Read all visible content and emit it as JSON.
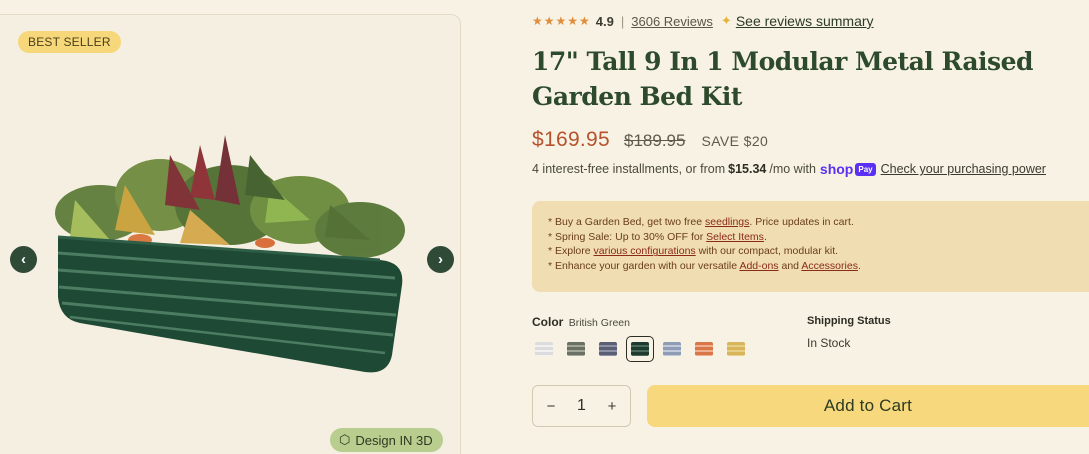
{
  "gallery": {
    "badge": "BEST SELLER",
    "prev_icon": "‹",
    "next_icon": "›",
    "design_label": "Design IN 3D",
    "design_icon": "⬡"
  },
  "product": {
    "stars": "★★★★★",
    "rating": "4.9",
    "rating_sep": "|",
    "reviews": "3606 Reviews",
    "sparkle_icon": "✦",
    "summary_link": "See reviews summary",
    "title": "17\" Tall 9 In 1 Modular Metal Raised Garden Bed Kit",
    "price": "$169.95",
    "old_price": "$189.95",
    "save": "SAVE $20",
    "installments_prefix": "4 interest-free installments, or from",
    "installments_amount": "$15.34",
    "installments_suffix": "/mo with",
    "shop_word": "shop",
    "pay_chip": "Pay",
    "power_link": "Check your purchasing power"
  },
  "promo": {
    "line1": {
      "a": "* Buy a Garden Bed, get two free ",
      "link": "seedlings",
      "b": ". Price updates in cart."
    },
    "line2": {
      "a": "* Spring Sale: Up to 30% OFF for ",
      "link": "Select Items",
      "b": "."
    },
    "line3": {
      "a": "* Explore ",
      "link": "various configurations",
      "b": " with our compact, modular kit."
    },
    "line4": {
      "a": "* Enhance your garden with our versatile ",
      "link": "Add-ons",
      "b": " and ",
      "link2": "Accessories",
      "c": "."
    }
  },
  "options": {
    "color_label": "Color",
    "color_value": "British Green",
    "swatches": [
      {
        "name": "light-gray",
        "c1": "#dcdcdc",
        "c2": "#f2f2f2"
      },
      {
        "name": "olive-gray",
        "c1": "#6b7064",
        "c2": "#a3a79a"
      },
      {
        "name": "slate-blue",
        "c1": "#5a5f73",
        "c2": "#8d92a6"
      },
      {
        "name": "british-green",
        "c1": "#1f3b30",
        "c2": "#4a6a5b"
      },
      {
        "name": "pale-blue",
        "c1": "#8f9cb5",
        "c2": "#c2cad9"
      },
      {
        "name": "orange",
        "c1": "#d8784a",
        "c2": "#f0b08f"
      },
      {
        "name": "gold",
        "c1": "#d8b55a",
        "c2": "#e8cf88"
      }
    ],
    "selected_swatch": 3,
    "shipping_label": "Shipping Status",
    "shipping_value": "In Stock"
  },
  "cart": {
    "minus": "−",
    "quantity": "1",
    "plus": "+",
    "add_label": "Add to Cart"
  }
}
